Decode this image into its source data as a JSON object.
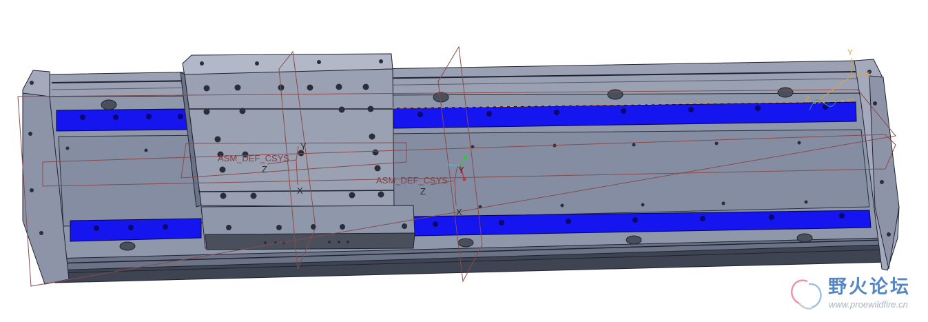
{
  "labels": {
    "csys_carriage": "ASM_DEF_CSYS",
    "csys_center": "ASM_DEF_CSYS",
    "axis_x": "X",
    "axis_y": "Y",
    "axis_z": "Z"
  },
  "watermark": {
    "chinese": "野火论坛",
    "url": "www.proewildfire.cn"
  },
  "colors": {
    "background": "#ffffff",
    "body": "#8f97ab",
    "body_dark": "#5f6677",
    "rail": "#1515f0",
    "datum_lines": "#8a4a4a",
    "edge": "#1f2230"
  }
}
